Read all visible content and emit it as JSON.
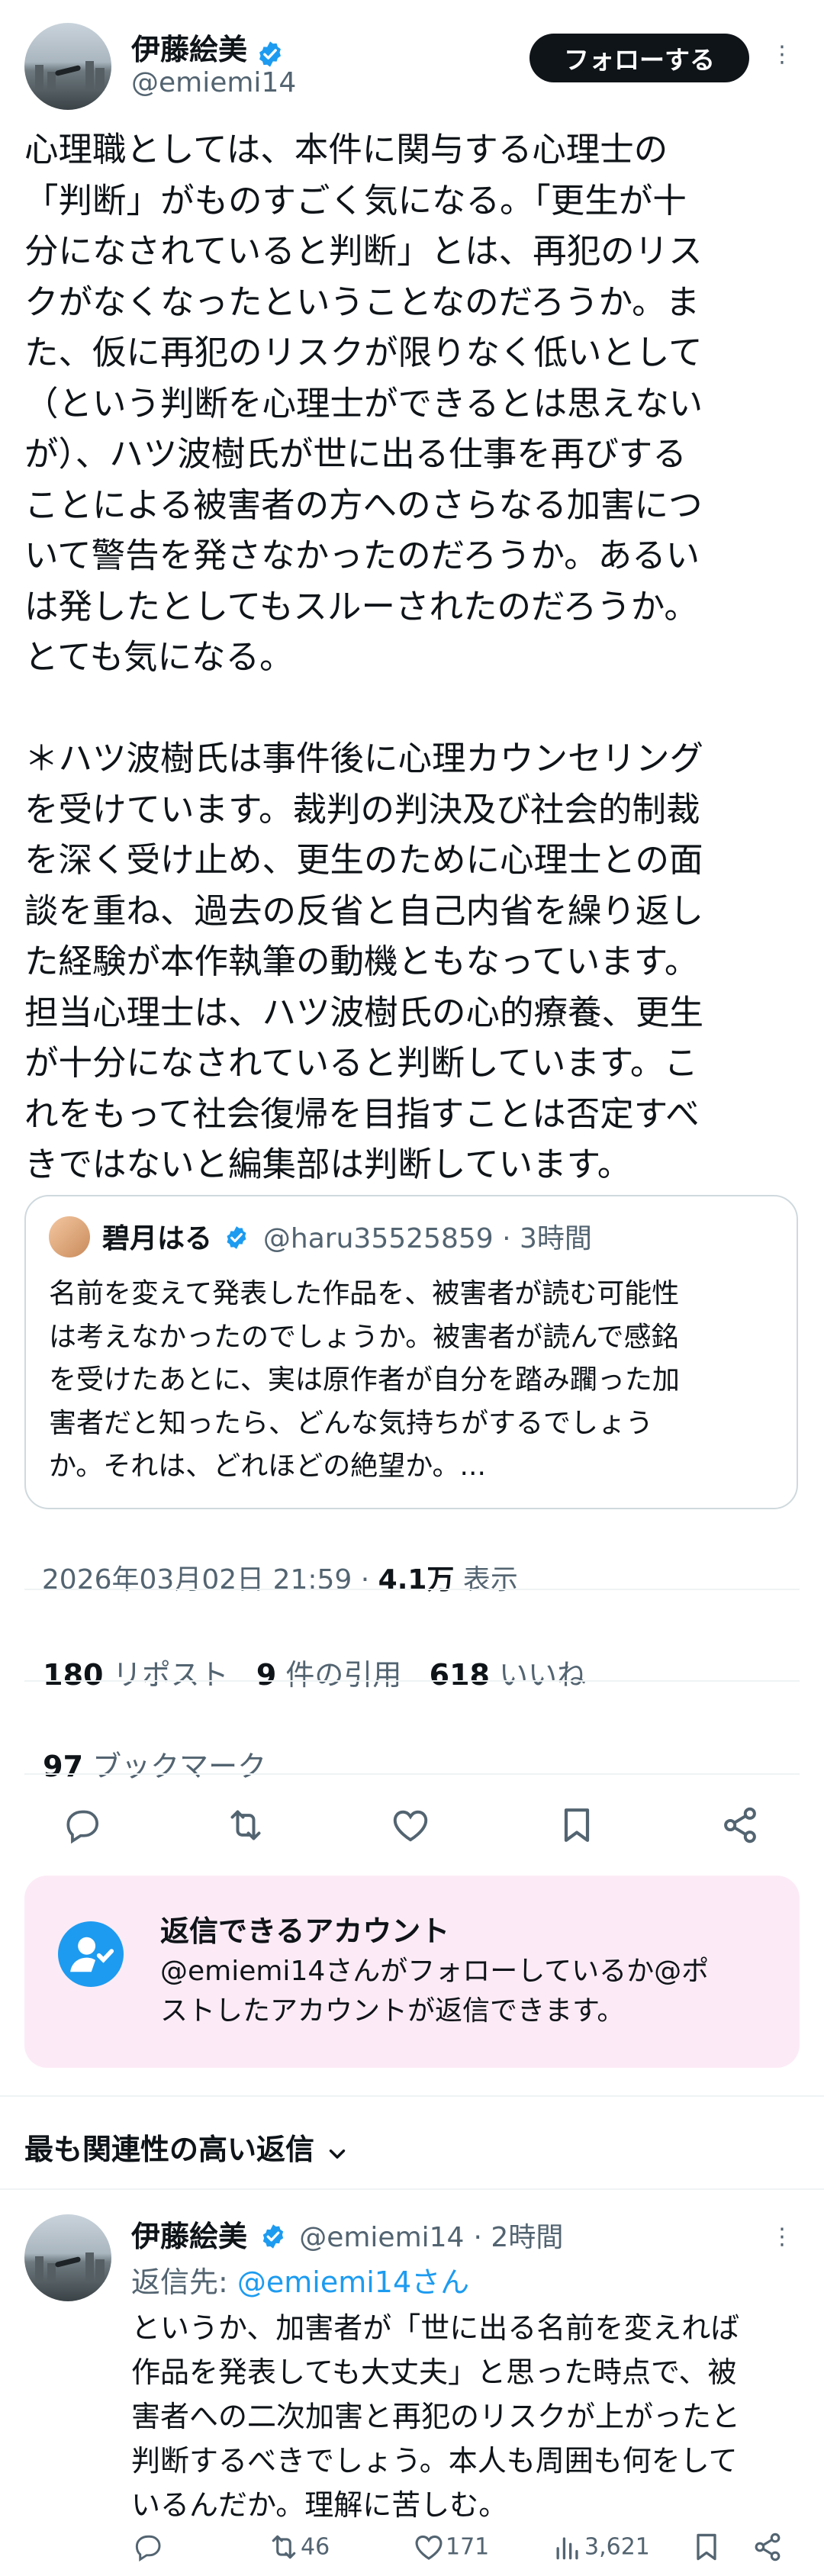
{
  "tweet": {
    "author_name": "伊藤絵美",
    "author_handle": "@emiemi14",
    "follow_label": "フォローする",
    "more_label": "⋮",
    "body_lines": [
      "心理職としては、本件に関与する心理士の",
      "「判断」がものすごく気になる。「更生が十",
      "分になされていると判断」とは、再犯のリス",
      "クがなくなったということなのだろうか。ま",
      "た、仮に再犯のリスクが限りなく低いとして",
      "（という判断を心理士ができるとは思えない",
      "が）、ハツ波樹氏が世に出る仕事を再びする",
      "ことによる被害者の方へのさらなる加害につ",
      "いて警告を発さなかったのだろうか。あるい",
      "は発したとしてもスルーされたのだろうか。",
      "とても気になる。",
      "",
      "＊ハツ波樹氏は事件後に心理カウンセリング",
      "を受けています。裁判の判決及び社会的制裁",
      "を深く受け止め、更生のために心理士との面",
      "談を重ね、過去の反省と自己内省を繰り返し",
      "た経験が本作執筆の動機ともなっています。",
      "担当心理士は、ハツ波樹氏の心的療養、更生",
      "が十分になされていると判断しています。こ",
      "れをもって社会復帰を目指すことは否定すべ",
      "きではないと編集部は判断しています。"
    ],
    "quote": {
      "author_name": "碧月はる",
      "author_handle": "@haru35525859",
      "time": "· 3時間",
      "text_lines": [
        "名前を変えて発表した作品を、被害者が読む可能性",
        "は考えなかったのでしょうか。被害者が読んで感銘",
        "を受けたあとに、実は原作者が自分を踏み躙った加",
        "害者だと知ったら、どんな気持ちがするでしょう",
        "か。それは、どれほどの絶望か。..."
      ]
    },
    "timestamp": "2026年03月02日 21:59 · ",
    "views_count": "4.1万",
    "views_label": " 表示",
    "reposts_count": "180",
    "reposts_label": " リポスト",
    "quotes_count": "9",
    "quotes_label": " 件の引用",
    "likes_count": "618",
    "likes_label": " いいね",
    "bookmarks_count": "97",
    "bookmarks_label": " ブックマーク"
  },
  "reply_restriction": {
    "title": "返信できるアカウント",
    "desc_lines": [
      "@emiemi14さんがフォローしているか@ポ",
      "ストしたアカウントが返信できます。"
    ]
  },
  "replies_section": {
    "title": "最も関連性の高い返信"
  },
  "reply": {
    "author_name": "伊藤絵美",
    "author_handle": "@emiemi14",
    "time": "· 2時間",
    "reply_to_prefix": "返信先: ",
    "reply_to_handle": "@emiemi14さん",
    "body_lines": [
      "というか、加害者が「世に出る名前を変えれば",
      "作品を発表しても大丈夫」と思った時点で、被",
      "害者への二次加害と再犯のリスクが上がったと",
      "判断するべきでしょう。本人も周囲も何をして",
      "いるんだか。理解に苦しむ。"
    ],
    "retweets": "46",
    "likes": "171",
    "views": "3,621"
  },
  "colors": {
    "accent": "#1d9bf0",
    "text": "#0f1419",
    "secondary": "#536471",
    "reply_box_bg": "#fcebf6"
  }
}
